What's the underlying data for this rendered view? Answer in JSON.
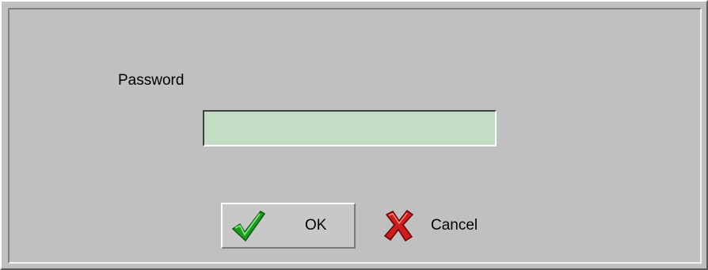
{
  "dialog": {
    "password_label": "Password",
    "password_value": "",
    "ok_label": "OK",
    "cancel_label": "Cancel",
    "ok_icon": "checkmark-icon",
    "cancel_icon": "x-icon",
    "colors": {
      "background": "#c0c0c0",
      "input_bg": "#c3dcc3",
      "check_green": "#1e9a1e",
      "x_red": "#c81e1e"
    }
  }
}
